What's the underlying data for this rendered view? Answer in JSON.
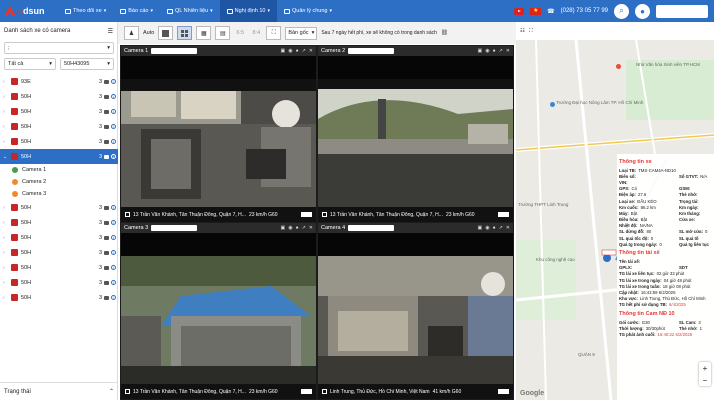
{
  "brand": {
    "name_prefix": "a",
    "name_rest": "dsun"
  },
  "nav": [
    {
      "label": "Theo dõi xe",
      "has_menu": true
    },
    {
      "label": "Báo cáo",
      "has_menu": true
    },
    {
      "label": "QL Nhiên liệu",
      "has_menu": true
    },
    {
      "label": "Nghị định 10",
      "has_menu": true,
      "active": true
    },
    {
      "label": "Quản lý chung",
      "has_menu": true
    }
  ],
  "topbar": {
    "phone": "(028) 73 05 77 99"
  },
  "sidebar": {
    "title": "Danh sách xe có camera",
    "group_select": ";",
    "status_select": "Tất cả",
    "plate_search": "50H43095",
    "vehicles": [
      {
        "plate": "93E",
        "count": "3"
      },
      {
        "plate": "50H",
        "count": "3"
      },
      {
        "plate": "50H",
        "count": "3"
      },
      {
        "plate": "50H",
        "count": "3"
      },
      {
        "plate": "50H",
        "count": "3"
      },
      {
        "plate": "50H",
        "count": "3",
        "selected": true
      }
    ],
    "cameras": [
      "Camera 1",
      "Camera 2",
      "Camera 3"
    ],
    "vehicles_after": [
      {
        "plate": "50H",
        "count": "3"
      },
      {
        "plate": "50H",
        "count": "3"
      },
      {
        "plate": "50H",
        "count": "3"
      },
      {
        "plate": "50H",
        "count": "3"
      },
      {
        "plate": "50H",
        "count": "3"
      },
      {
        "plate": "50H",
        "count": "3"
      },
      {
        "plate": "50H",
        "count": "3"
      }
    ],
    "status_label": "Trạng thái"
  },
  "toolbar": {
    "auto_label": "Auto",
    "ratio1": "6:5",
    "ratio2": "8:4",
    "source_select": "Bản gốc",
    "note": "Sau 7 ngày hết phí, xe sẽ không có trong danh sách"
  },
  "cameras": [
    {
      "title": "Camera 1",
      "address": "13 Trần Văn Khánh, Tân Thuận Đông, Quận 7, H...",
      "speed": "23 km/h G60"
    },
    {
      "title": "Camera 2",
      "address": "13 Trần Văn Khánh, Tân Thuận Đông, Quận 7, H...",
      "speed": "23 km/h G60"
    },
    {
      "title": "Camera 3",
      "address": "13 Trần Văn Khánh, Tân Thuận Đông, Quận 7, H...",
      "speed": "23 km/h G60"
    },
    {
      "title": "Camera 4",
      "address": "Linh Trung, Thủ Đức, Hồ Chí Minh, Việt Nam",
      "speed": "41 km/h G60"
    }
  ],
  "map": {
    "labels": [
      "Nhà Văn hóa Sinh viên TP.HCM",
      "Trường Đại học Nông Lâm TP. Hồ Chí Minh",
      "Trường THPT Linh Trung",
      "Khu công nghệ cao",
      "QUẬN 9"
    ],
    "google": "Google"
  },
  "vehicle_info": {
    "title": "Thông tin xe",
    "rows": [
      {
        "k": "Loại TB:",
        "v": "TMS-CAM4A-ND10"
      },
      {
        "k": "Biển số:",
        "v": "",
        "k2": "Số GTVT:",
        "v2": "N/A"
      },
      {
        "k": "VIN:",
        "v": ""
      },
      {
        "k": "GPS:",
        "v": "Có",
        "k2": "GSM:",
        "v2": ""
      },
      {
        "k": "Điện áp:",
        "v": "27.6",
        "k2": "Thẻ nhớ:",
        "v2": ""
      },
      {
        "k": "Loại xe:",
        "v": "ĐẦU KÉO",
        "k2": "Trọng tải:",
        "v2": ""
      },
      {
        "k": "Km cuốc:",
        "v": "86.2 km",
        "k2": "Km ngày:",
        "v2": ""
      },
      {
        "k": "Máy:",
        "v": "Bật",
        "k2": "Km tháng:",
        "v2": ""
      },
      {
        "k": "Điều hòa:",
        "v": "Bật",
        "k2": "Cửa xe:",
        "v2": ""
      },
      {
        "k": "Nhiệt độ:",
        "v": "NA/NA"
      },
      {
        "k": "SL dừng đỗ:",
        "v": "80",
        "k2": "SL mở cửa:",
        "v2": "0"
      },
      {
        "k": "SL quá tốc độ:",
        "v": "0",
        "k2": "SL quá tố",
        "v2": ""
      },
      {
        "k": "Quá tg trong ngày:",
        "v": "0",
        "k2": "Quá tg liên tục",
        "v2": ""
      }
    ]
  },
  "driver_info": {
    "title": "Thông tin tài xế",
    "rows": [
      {
        "k": "Tên tài xế:",
        "v": ""
      },
      {
        "k": "GPLX:",
        "v": "",
        "k2": "SDT",
        "v2": ""
      },
      {
        "k": "TG lái xe liên tục:",
        "v": "02 giờ 33 phút"
      },
      {
        "k": "TG lái xe trong ngày:",
        "v": "04 giờ 48 phút"
      },
      {
        "k": "TG lái xe trong tuần:",
        "v": "18 giờ 08 phút"
      },
      {
        "k": "Cập nhật:",
        "v": "16:43:59 6/2/2025"
      },
      {
        "k": "Khu vực:",
        "v": "Linh Trung, Thủ Đức, Hồ Chí Minh"
      },
      {
        "k": "TG hết phí sử dụng TB:",
        "v": "6/4/2025"
      }
    ]
  },
  "cam_info": {
    "title": "Thông tin Cam NĐ 10",
    "rows": [
      {
        "k": "Gói cước:",
        "v": "G30",
        "k2": "SL Cam:",
        "v2": "3"
      },
      {
        "k": "Thời lượng:",
        "v": "30/30phút",
        "k2": "Thẻ nhớ:",
        "v2": "1"
      },
      {
        "k": "TG phát ảnh cuối:",
        "v": "16:40:22 6/2/2025"
      }
    ]
  }
}
